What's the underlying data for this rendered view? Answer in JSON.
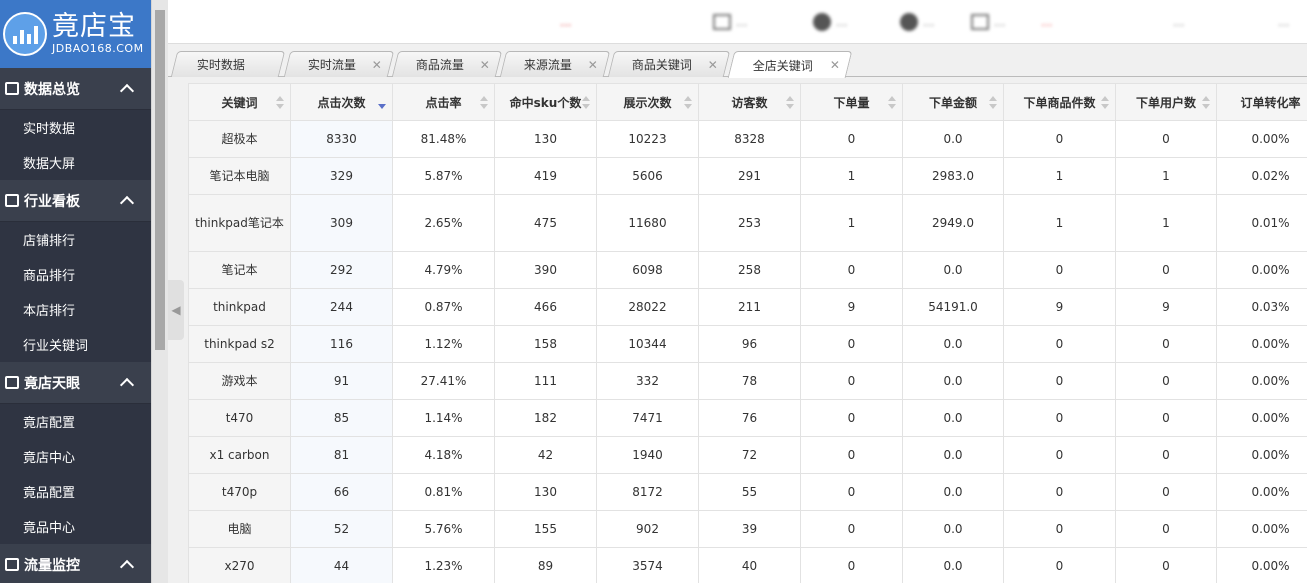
{
  "brand": {
    "name": "竟店宝",
    "url": "JDBAO168.COM"
  },
  "sidebar": {
    "sections": [
      {
        "label": "数据总览",
        "icon": "bag-icon",
        "items": [
          "实时数据",
          "数据大屏"
        ]
      },
      {
        "label": "行业看板",
        "icon": "bag-icon",
        "items": [
          "店铺排行",
          "商品排行",
          "本店排行",
          "行业关键词"
        ]
      },
      {
        "label": "竟店天眼",
        "icon": "eye-box-icon",
        "items": [
          "竟店配置",
          "竟店中心",
          "竟品配置",
          "竟品中心"
        ]
      },
      {
        "label": "流量监控",
        "icon": "list-icon",
        "items": []
      }
    ]
  },
  "header": {
    "items": [
      "...",
      "...",
      "...",
      "...",
      "...",
      "...",
      "...",
      "..."
    ]
  },
  "tabs": [
    {
      "label": "实时数据",
      "closable": false
    },
    {
      "label": "实时流量",
      "closable": true
    },
    {
      "label": "商品流量",
      "closable": true
    },
    {
      "label": "来源流量",
      "closable": true
    },
    {
      "label": "商品关键词",
      "closable": true
    },
    {
      "label": "全店关键词",
      "closable": true,
      "active": true
    }
  ],
  "table": {
    "columns": [
      "关键词",
      "点击次数",
      "点击率",
      "命中sku个数",
      "展示次数",
      "访客数",
      "下单量",
      "下单金额",
      "下单商品件数",
      "下单用户数",
      "订单转化率"
    ],
    "sorted_column": "点击次数",
    "sort_direction": "desc",
    "rows": [
      [
        "超极本",
        "8330",
        "81.48%",
        "130",
        "10223",
        "8328",
        "0",
        "0.0",
        "0",
        "0",
        "0.00%"
      ],
      [
        "笔记本电脑",
        "329",
        "5.87%",
        "419",
        "5606",
        "291",
        "1",
        "2983.0",
        "1",
        "1",
        "0.02%"
      ],
      [
        "thinkpad笔记本",
        "309",
        "2.65%",
        "475",
        "11680",
        "253",
        "1",
        "2949.0",
        "1",
        "1",
        "0.01%"
      ],
      [
        "笔记本",
        "292",
        "4.79%",
        "390",
        "6098",
        "258",
        "0",
        "0.0",
        "0",
        "0",
        "0.00%"
      ],
      [
        "thinkpad",
        "244",
        "0.87%",
        "466",
        "28022",
        "211",
        "9",
        "54191.0",
        "9",
        "9",
        "0.03%"
      ],
      [
        "thinkpad s2",
        "116",
        "1.12%",
        "158",
        "10344",
        "96",
        "0",
        "0.0",
        "0",
        "0",
        "0.00%"
      ],
      [
        "游戏本",
        "91",
        "27.41%",
        "111",
        "332",
        "78",
        "0",
        "0.0",
        "0",
        "0",
        "0.00%"
      ],
      [
        "t470",
        "85",
        "1.14%",
        "182",
        "7471",
        "76",
        "0",
        "0.0",
        "0",
        "0",
        "0.00%"
      ],
      [
        "x1 carbon",
        "81",
        "4.18%",
        "42",
        "1940",
        "72",
        "0",
        "0.0",
        "0",
        "0",
        "0.00%"
      ],
      [
        "t470p",
        "66",
        "0.81%",
        "130",
        "8172",
        "55",
        "0",
        "0.0",
        "0",
        "0",
        "0.00%"
      ],
      [
        "电脑",
        "52",
        "5.76%",
        "155",
        "902",
        "39",
        "0",
        "0.0",
        "0",
        "0",
        "0.00%"
      ],
      [
        "x270",
        "44",
        "1.23%",
        "89",
        "3574",
        "40",
        "0",
        "0.0",
        "0",
        "0",
        "0.00%"
      ]
    ]
  },
  "colors": {
    "sidebar_bg": "#2f3442",
    "section_bg": "#3a404d",
    "logo_bg": "#3c78c8",
    "sort_active": "#5a6fc8"
  }
}
